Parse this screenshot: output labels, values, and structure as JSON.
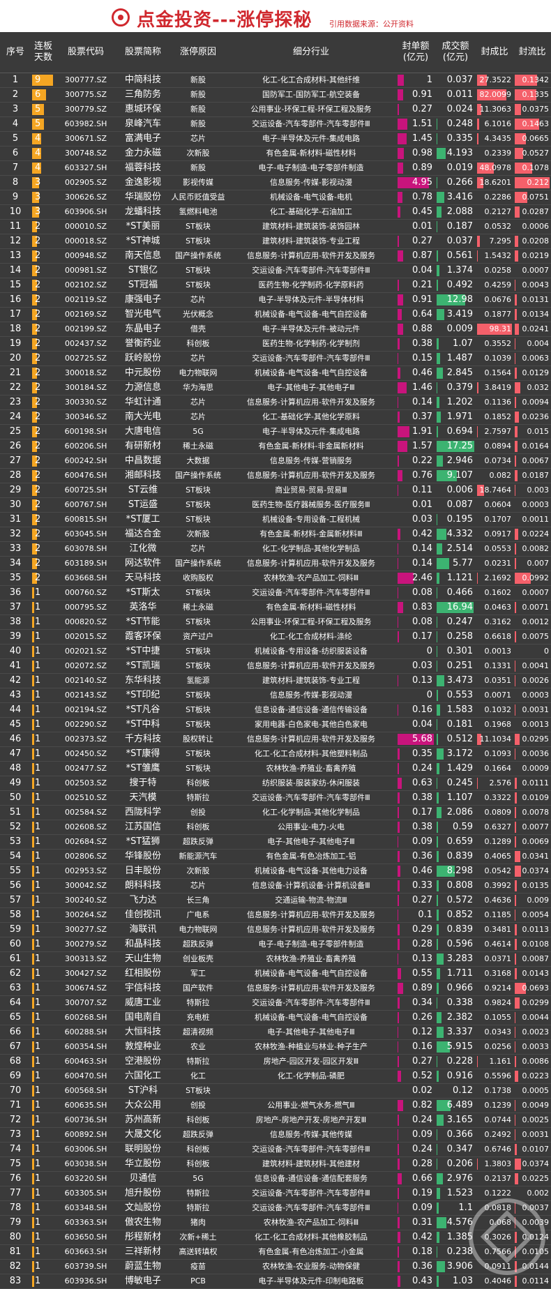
{
  "header": {
    "title": "点金投资---涨停探秘",
    "source": "引用数据来源：公开资料"
  },
  "columns": {
    "no": "序号",
    "days": "连板\n天数",
    "code": "股票代码",
    "name": "股票简称",
    "reason": "涨停原因",
    "industry": "细分行业",
    "seal": "封单额\n(亿元)",
    "vol": "成交额\n(亿元)",
    "ratio": "封成比",
    "flow": "封流比"
  },
  "colors": {
    "days_bar": "#f5a623",
    "seal_bar": "#c8147c",
    "vol_bar": "#3cb371",
    "ratio_bar": "#f4606a",
    "title": "#d0282e"
  },
  "rows": [
    [
      "1",
      "9",
      "300777.SZ",
      "中简科技",
      "新股",
      "化工-化工合成材料-其他纤维",
      "1",
      "0.037",
      "27.3522",
      "0.1342"
    ],
    [
      "2",
      "6",
      "300775.SZ",
      "三角防务",
      "新股",
      "国防军工-国防军工-航空装备",
      "0.91",
      "0.011",
      "82.0099",
      "0.1335"
    ],
    [
      "3",
      "5",
      "300779.SZ",
      "惠城环保",
      "新股",
      "公用事业-环保工程-环保工程及服务",
      "0.27",
      "0.024",
      "11.3063",
      "0.0375"
    ],
    [
      "4",
      "5",
      "603982.SH",
      "泉峰汽车",
      "新股",
      "交运设备-汽车零部件-汽车零部件Ⅲ",
      "1.51",
      "0.248",
      "6.1016",
      "0.1463"
    ],
    [
      "5",
      "4",
      "300671.SZ",
      "富满电子",
      "芯片",
      "电子-半导体及元件-集成电路",
      "1.45",
      "0.335",
      "4.3435",
      "0.0665"
    ],
    [
      "6",
      "4",
      "300748.SZ",
      "金力永磁",
      "次新股",
      "有色金属-新材料-磁性材料",
      "0.98",
      "4.193",
      "0.2339",
      "0.0527"
    ],
    [
      "7",
      "4",
      "603327.SH",
      "福蓉科技",
      "新股",
      "电子-电子制造-电子零部件制造",
      "0.89",
      "0.019",
      "48.0978",
      "0.1078"
    ],
    [
      "8",
      "3",
      "002905.SZ",
      "金逸影视",
      "影视传媒",
      "信息服务-传媒-影视动漫",
      "4.95",
      "0.266",
      "18.6201",
      "0.212"
    ],
    [
      "9",
      "3",
      "300626.SZ",
      "华瑞股份",
      "人民币贬值受益",
      "机械设备-电气设备-电机",
      "0.78",
      "3.416",
      "0.2286",
      "0.0751"
    ],
    [
      "10",
      "3",
      "603906.SH",
      "龙蟠科技",
      "氢燃料电池",
      "化工-基础化学-石油加工",
      "0.45",
      "2.088",
      "0.2127",
      "0.0287"
    ],
    [
      "11",
      "2",
      "000010.SZ",
      "*ST美丽",
      "ST板块",
      "建筑材料-建筑装饰-装饰园林",
      "0.01",
      "0.187",
      "0.0532",
      "0.0006"
    ],
    [
      "12",
      "2",
      "000018.SZ",
      "*ST神城",
      "ST板块",
      "建筑材料-建筑装饰-专业工程",
      "0.27",
      "0.037",
      "7.295",
      "0.0208"
    ],
    [
      "13",
      "2",
      "000948.SZ",
      "南天信息",
      "国产操作系统",
      "信息服务-计算机应用-软件开发及服务",
      "0.87",
      "0.561",
      "1.5432",
      "0.0219"
    ],
    [
      "14",
      "2",
      "000981.SZ",
      "ST银亿",
      "ST板块",
      "交运设备-汽车零部件-汽车零部件Ⅲ",
      "0.04",
      "1.374",
      "0.0258",
      "0.0007"
    ],
    [
      "15",
      "2",
      "002102.SZ",
      "ST冠福",
      "ST板块",
      "医药生物-化学制药-化学原料药",
      "0.21",
      "0.492",
      "0.4259",
      "0.0043"
    ],
    [
      "16",
      "2",
      "002119.SZ",
      "康强电子",
      "芯片",
      "电子-半导体及元件-半导体材料",
      "0.91",
      "12.98",
      "0.0676",
      "0.0131"
    ],
    [
      "17",
      "2",
      "002169.SZ",
      "智光电气",
      "光伏概念",
      "机械设备-电气设备-电气自控设备",
      "0.64",
      "3.419",
      "0.1877",
      "0.0134"
    ],
    [
      "18",
      "2",
      "002199.SZ",
      "东晶电子",
      "借壳",
      "电子-半导体及元件-被动元件",
      "0.88",
      "0.009",
      "98.31",
      "0.0241"
    ],
    [
      "19",
      "2",
      "002437.SZ",
      "誉衡药业",
      "科创板",
      "医药生物-化学制药-化学制剂",
      "0.38",
      "1.07",
      "0.3552",
      "0.004"
    ],
    [
      "20",
      "2",
      "002725.SZ",
      "跃岭股份",
      "芯片",
      "交运设备-汽车零部件-汽车零部件Ⅲ",
      "0.15",
      "1.487",
      "0.1039",
      "0.0063"
    ],
    [
      "21",
      "2",
      "300018.SZ",
      "中元股份",
      "电力物联网",
      "机械设备-电气设备-电气自控设备",
      "0.46",
      "2.845",
      "0.1564",
      "0.0129"
    ],
    [
      "22",
      "2",
      "300184.SZ",
      "力源信息",
      "华为海思",
      "电子-其他电子-其他电子Ⅲ",
      "1.46",
      "0.379",
      "3.8419",
      "0.032"
    ],
    [
      "23",
      "2",
      "300330.SZ",
      "华虹计通",
      "芯片",
      "信息服务-计算机应用-软件开发及服务",
      "0.14",
      "1.202",
      "0.1136",
      "0.0094"
    ],
    [
      "24",
      "2",
      "300346.SZ",
      "南大光电",
      "芯片",
      "化工-基础化学-其他化学原料",
      "0.37",
      "1.971",
      "0.1852",
      "0.0236"
    ],
    [
      "25",
      "2",
      "600198.SH",
      "大唐电信",
      "5G",
      "电子-半导体及元件-集成电路",
      "1.91",
      "0.694",
      "2.7597",
      "0.015"
    ],
    [
      "26",
      "2",
      "600206.SH",
      "有研新材",
      "稀土永磁",
      "有色金属-新材料-非金属新材料",
      "1.57",
      "17.25",
      "0.0894",
      "0.0164"
    ],
    [
      "27",
      "2",
      "600242.SH",
      "中昌数据",
      "大数据",
      "信息服务-传媒-营销服务",
      "0.22",
      "2.946",
      "0.0734",
      "0.0067"
    ],
    [
      "28",
      "2",
      "600476.SH",
      "湘邮科技",
      "国产操作系统",
      "信息服务-计算机应用-软件开发及服务",
      "0.76",
      "9.107",
      "0.082",
      "0.0187"
    ],
    [
      "29",
      "2",
      "600725.SH",
      "ST云维",
      "ST板块",
      "商业贸易-贸易-贸易Ⅲ",
      "0.11",
      "0.006",
      "18.7464",
      "0.003"
    ],
    [
      "30",
      "2",
      "600767.SH",
      "ST运盛",
      "ST板块",
      "医药生物-医疗器械服务-医疗服务Ⅲ",
      "0.01",
      "0.087",
      "0.0604",
      "0.0003"
    ],
    [
      "31",
      "2",
      "600815.SH",
      "*ST厦工",
      "ST板块",
      "机械设备-专用设备-工程机械",
      "0.03",
      "0.195",
      "0.1707",
      "0.0011"
    ],
    [
      "32",
      "2",
      "603045.SH",
      "福达合金",
      "次新股",
      "有色金属-新材料-金属新材料Ⅲ",
      "0.42",
      "4.332",
      "0.0917",
      "0.0224"
    ],
    [
      "33",
      "2",
      "603078.SH",
      "江化微",
      "芯片",
      "化工-化学制品-其他化学制品",
      "0.14",
      "2.514",
      "0.0553",
      "0.0082"
    ],
    [
      "34",
      "2",
      "603189.SH",
      "网达软件",
      "国产操作系统",
      "信息服务-计算机应用-软件开发及服务",
      "0.14",
      "5.77",
      "0.0231",
      "0.007"
    ],
    [
      "35",
      "2",
      "603668.SH",
      "天马科技",
      "收购股权",
      "农林牧渔-农产品加工-饲料Ⅲ",
      "2.46",
      "1.121",
      "2.1692",
      "0.0992"
    ],
    [
      "36",
      "1",
      "000760.SZ",
      "*ST斯太",
      "ST板块",
      "交运设备-汽车零部件-汽车零部件Ⅲ",
      "0.08",
      "0.466",
      "0.1602",
      "0.0007"
    ],
    [
      "37",
      "1",
      "000795.SZ",
      "英洛华",
      "稀土永磁",
      "有色金属-新材料-磁性材料",
      "0.83",
      "16.94",
      "0.0463",
      "0.0071"
    ],
    [
      "38",
      "1",
      "000820.SZ",
      "*ST节能",
      "ST板块",
      "公用事业-环保工程-环保工程及服务",
      "0.08",
      "0.247",
      "0.3162",
      "0.0012"
    ],
    [
      "39",
      "1",
      "002015.SZ",
      "霞客环保",
      "资产过户",
      "化工-化工合成材料-涤纶",
      "0.17",
      "0.258",
      "0.6618",
      "0.0075"
    ],
    [
      "40",
      "1",
      "002021.SZ",
      "*ST中捷",
      "ST板块",
      "机械设备-专用设备-纺织服装设备",
      "0",
      "0.301",
      "0.0013",
      "0"
    ],
    [
      "41",
      "1",
      "002072.SZ",
      "*ST凯瑞",
      "ST板块",
      "信息服务-计算机应用-软件开发及服务",
      "0.03",
      "0.251",
      "0.1331",
      "0.0041"
    ],
    [
      "42",
      "1",
      "002140.SZ",
      "东华科技",
      "氢能源",
      "建筑材料-建筑装饰-专业工程",
      "0.13",
      "3.473",
      "0.0351",
      "0.0026"
    ],
    [
      "43",
      "1",
      "002143.SZ",
      "*ST印纪",
      "ST板块",
      "信息服务-传媒-影视动漫",
      "0",
      "0.553",
      "0.0071",
      "0.0003"
    ],
    [
      "44",
      "1",
      "002194.SZ",
      "*ST凡谷",
      "ST板块",
      "信息设备-通信设备-通信传输设备",
      "0.16",
      "1.583",
      "0.1032",
      "0.0031"
    ],
    [
      "45",
      "1",
      "002290.SZ",
      "*ST中科",
      "ST板块",
      "家用电器-白色家电-其他白色家电",
      "0.04",
      "0.181",
      "0.1968",
      "0.0013"
    ],
    [
      "46",
      "1",
      "002373.SZ",
      "千方科技",
      "股权转让",
      "信息服务-计算机应用-软件开发及服务",
      "5.68",
      "0.512",
      "11.1034",
      "0.0295"
    ],
    [
      "47",
      "1",
      "002450.SZ",
      "*ST康得",
      "ST板块",
      "化工-化工合成材料-其他塑料制品",
      "0.35",
      "3.172",
      "0.1093",
      "0.0036"
    ],
    [
      "48",
      "1",
      "002477.SZ",
      "*ST雏鹰",
      "ST板块",
      "农林牧渔-养殖业-畜禽养殖",
      "0.24",
      "1.429",
      "0.1664",
      "0.0009"
    ],
    [
      "49",
      "1",
      "002503.SZ",
      "搜于特",
      "科创板",
      "纺织服装-服装家纺-休闲服装",
      "0.63",
      "0.245",
      "2.576",
      "0.0111"
    ],
    [
      "50",
      "1",
      "002510.SZ",
      "天汽模",
      "特斯拉",
      "交运设备-汽车零部件-汽车零部件Ⅲ",
      "0.38",
      "1.107",
      "0.3322",
      "0.0109"
    ],
    [
      "51",
      "1",
      "002584.SZ",
      "西陇科学",
      "创投",
      "化工-化学制品-其他化学制品",
      "0.17",
      "2.086",
      "0.0809",
      "0.0078"
    ],
    [
      "52",
      "1",
      "002608.SZ",
      "江苏国信",
      "科创板",
      "公用事业-电力-火电",
      "0.38",
      "0.59",
      "0.6327",
      "0.0077"
    ],
    [
      "53",
      "1",
      "002684.SZ",
      "*ST猛狮",
      "超跌反弹",
      "电子-其他电子-其他电子Ⅲ",
      "0.09",
      "0.659",
      "0.1289",
      "0.0069"
    ],
    [
      "54",
      "1",
      "002806.SZ",
      "华锋股份",
      "新能源汽车",
      "有色金属-有色冶炼加工-铝",
      "0.36",
      "0.839",
      "0.4065",
      "0.0341"
    ],
    [
      "55",
      "1",
      "002953.SZ",
      "日丰股份",
      "次新股",
      "机械设备-电气设备-其他电力设备",
      "0.46",
      "8.298",
      "0.0542",
      "0.0374"
    ],
    [
      "56",
      "1",
      "300042.SZ",
      "朗科科技",
      "芯片",
      "信息设备-计算机设备-计算机设备Ⅲ",
      "0.33",
      "0.808",
      "0.3992",
      "0.0135"
    ],
    [
      "57",
      "1",
      "300240.SZ",
      "飞力达",
      "长三角",
      "交通运输-物流-物流Ⅲ",
      "0.27",
      "0.572",
      "0.4636",
      "0.009"
    ],
    [
      "58",
      "1",
      "300264.SZ",
      "佳创视讯",
      "广电系",
      "信息服务-计算机应用-软件开发及服务",
      "0.1",
      "0.852",
      "0.1185",
      "0.0054"
    ],
    [
      "59",
      "1",
      "300277.SZ",
      "海联讯",
      "电力物联网",
      "信息服务-计算机应用-软件开发及服务",
      "0.29",
      "0.839",
      "0.3481",
      "0.0113"
    ],
    [
      "60",
      "1",
      "300279.SZ",
      "和晶科技",
      "超跌反弹",
      "电子-电子制造-电子零部件制造",
      "0.28",
      "0.596",
      "0.4614",
      "0.0108"
    ],
    [
      "61",
      "1",
      "300313.SZ",
      "天山生物",
      "创业板壳",
      "农林牧渔-养殖业-畜禽养殖",
      "0.13",
      "3.283",
      "0.0371",
      "0.0087"
    ],
    [
      "62",
      "1",
      "300427.SZ",
      "红相股份",
      "军工",
      "机械设备-电气设备-电气自控设备",
      "0.55",
      "1.711",
      "0.3168",
      "0.0143"
    ],
    [
      "63",
      "1",
      "300674.SZ",
      "宇信科技",
      "国产软件",
      "信息服务-计算机应用-软件开发及服务",
      "0.89",
      "0.966",
      "0.9214",
      "0.0693"
    ],
    [
      "64",
      "1",
      "300707.SZ",
      "威唐工业",
      "特斯拉",
      "交运设备-汽车零部件-汽车零部件Ⅲ",
      "0.34",
      "0.338",
      "0.9824",
      "0.0299"
    ],
    [
      "65",
      "1",
      "600268.SH",
      "国电南自",
      "充电桩",
      "机械设备-电气设备-电气自控设备",
      "0.26",
      "2.382",
      "0.1055",
      "0.0044"
    ],
    [
      "66",
      "1",
      "600288.SH",
      "大恒科技",
      "超清视频",
      "电子-其他电子-其他电子Ⅲ",
      "0.12",
      "3.337",
      "0.0343",
      "0.0023"
    ],
    [
      "67",
      "1",
      "600354.SH",
      "敦煌种业",
      "农业",
      "农林牧渔-种植业与林业-种子生产",
      "0.16",
      "5.915",
      "0.0256",
      "0.0033"
    ],
    [
      "68",
      "1",
      "600463.SH",
      "空港股份",
      "特斯拉",
      "房地产-园区开发-园区开发Ⅲ",
      "0.27",
      "0.228",
      "1.161",
      "0.0086"
    ],
    [
      "69",
      "1",
      "600470.SH",
      "六国化工",
      "化工",
      "化工-化学制品-磷肥",
      "0.52",
      "0.916",
      "0.5596",
      "0.0223"
    ],
    [
      "70",
      "1",
      "600568.SH",
      "ST沪科",
      "ST板块",
      "",
      "0.02",
      "0.12",
      "0.1738",
      "0.0005"
    ],
    [
      "71",
      "1",
      "600635.SH",
      "大众公用",
      "创投",
      "公用事业-燃气水务-燃气Ⅲ",
      "0.82",
      "6.489",
      "0.1239",
      "0.0049"
    ],
    [
      "72",
      "1",
      "600736.SH",
      "苏州高新",
      "科创板",
      "房地产-房地产开发-房地产开发Ⅲ",
      "0.24",
      "3.165",
      "0.0744",
      "0.0025"
    ],
    [
      "73",
      "1",
      "600892.SH",
      "大晟文化",
      "超跌反弹",
      "信息服务-传媒-其他传媒",
      "0.09",
      "0.366",
      "0.2492",
      "0.0031"
    ],
    [
      "74",
      "1",
      "603006.SH",
      "联明股份",
      "科创板",
      "交运设备-汽车零部件-汽车零部件Ⅲ",
      "0.24",
      "0.347",
      "0.6746",
      "0.0107"
    ],
    [
      "75",
      "1",
      "603038.SH",
      "华立股份",
      "科创板",
      "建筑材料-建筑材料-其他建材",
      "0.28",
      "0.206",
      "1.3803",
      "0.0374"
    ],
    [
      "76",
      "1",
      "603220.SH",
      "贝通信",
      "5G",
      "信息设备-通信设备-通信配套服务",
      "0.66",
      "2.976",
      "0.2137",
      "0.0225"
    ],
    [
      "77",
      "1",
      "603305.SH",
      "旭升股份",
      "特斯拉",
      "交运设备-汽车零部件-汽车零部件Ⅲ",
      "0.19",
      "1.523",
      "0.1222",
      "0.002"
    ],
    [
      "78",
      "1",
      "603348.SH",
      "文灿股份",
      "特斯拉",
      "交运设备-汽车零部件-汽车零部件Ⅲ",
      "0.09",
      "1.1",
      "0.0818",
      "0.0037"
    ],
    [
      "79",
      "1",
      "603363.SH",
      "傲农生物",
      "猪肉",
      "农林牧渔-农产品加工-饲料Ⅲ",
      "0.31",
      "4.576",
      "0.068",
      "0.0039"
    ],
    [
      "80",
      "1",
      "603650.SH",
      "彤程新材",
      "次新+稀土",
      "化工-化工合成材料-其他橡胶制品",
      "0.42",
      "1.385",
      "0.3026",
      "0.0124"
    ],
    [
      "81",
      "1",
      "603663.SH",
      "三祥新材",
      "高送转填权",
      "有色金属-有色冶炼加工-小金属",
      "0.18",
      "0.238",
      "0.7566",
      "0.0105"
    ],
    [
      "82",
      "1",
      "603739.SH",
      "蔚蓝生物",
      "疫苗",
      "农林牧渔-农业服务-动物保健",
      "0.36",
      "3.906",
      "0.0911",
      "0.0144"
    ],
    [
      "83",
      "1",
      "603936.SH",
      "博敏电子",
      "PCB",
      "电子-半导体及元件-印制电路板",
      "0.43",
      "1.03",
      "0.4046",
      "0.0114"
    ]
  ]
}
